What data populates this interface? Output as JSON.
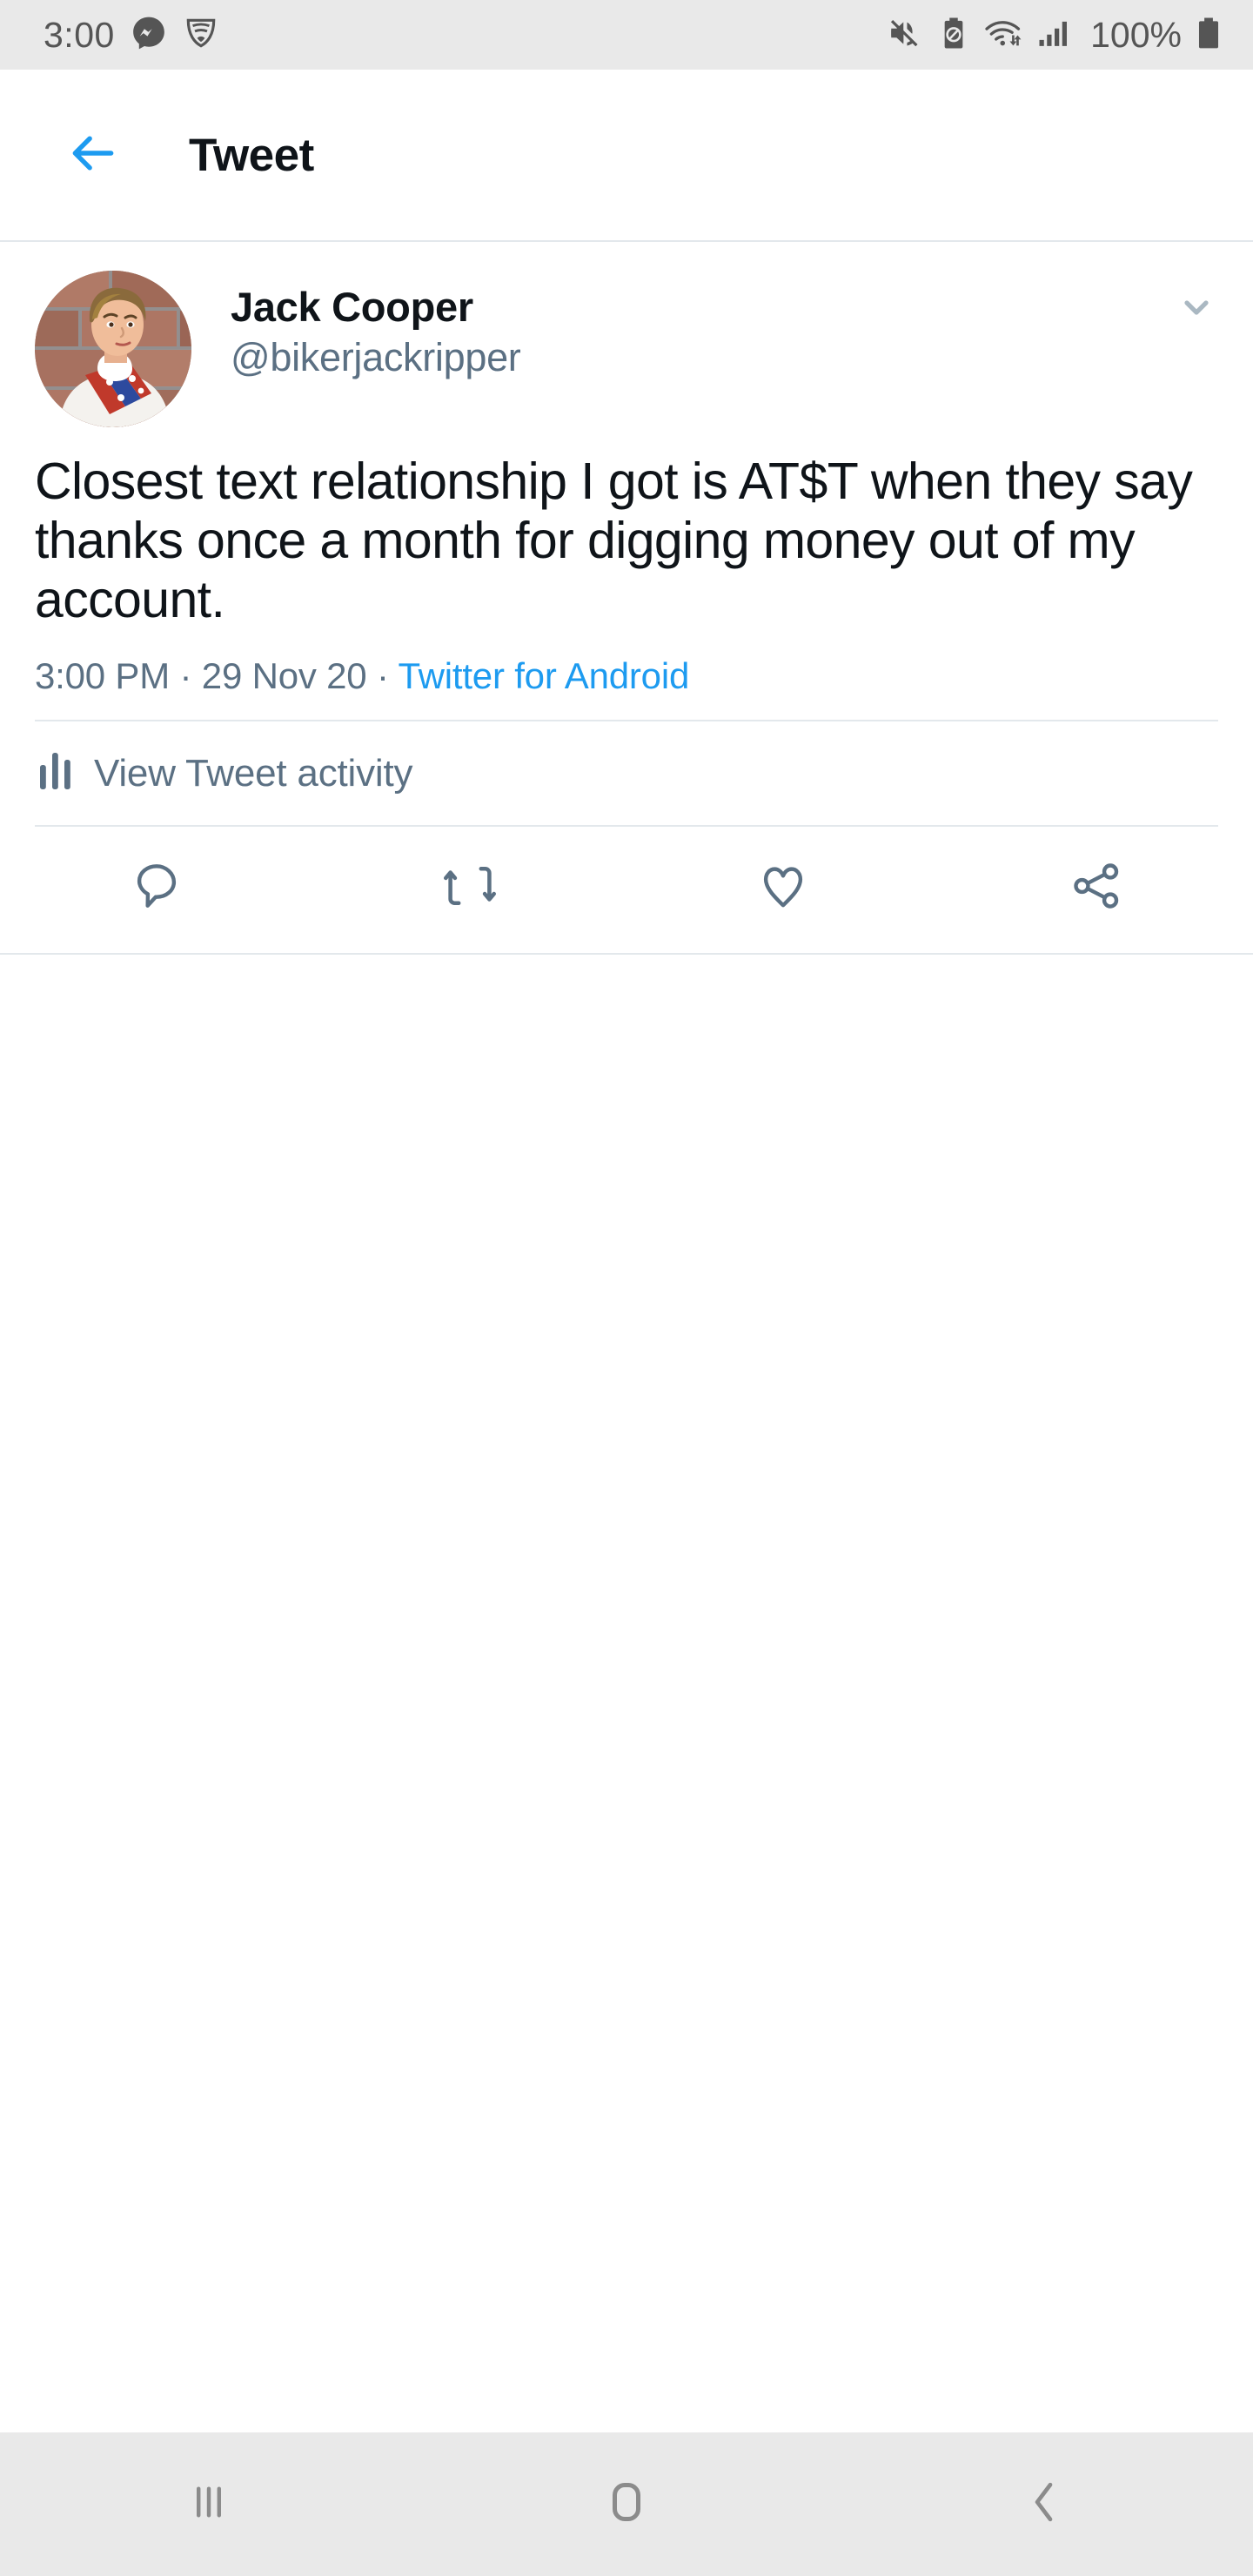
{
  "status_bar": {
    "clock": "3:00",
    "battery_percent": "100%",
    "left_icons": [
      "messenger-icon",
      "wifi-shield-icon"
    ],
    "right_icons": [
      "mute-icon",
      "battery-saver-icon",
      "wifi-icon",
      "cellular-signal-icon",
      "battery-icon"
    ],
    "bg_color": "#e9e9e9",
    "fg_color": "#555555"
  },
  "header": {
    "title": "Tweet",
    "back_icon": "arrow-left-icon",
    "accent_color": "#1d9bf0"
  },
  "tweet": {
    "author": {
      "display_name": "Jack Cooper",
      "handle": "@bikerjackripper",
      "avatar_alt": "Evel Knievel action figure in white jumpsuit against brick wall"
    },
    "menu_icon": "chevron-down-icon",
    "text": "Closest text relationship I got is AT$T when they say thanks once a month for digging money out of my account.",
    "meta": {
      "time": "3:00 PM",
      "separator": "·",
      "date": "29 Nov 20",
      "source": "Twitter for Android",
      "source_color": "#1d9bf0"
    },
    "activity": {
      "label": "View Tweet activity",
      "icon": "bar-chart-icon"
    },
    "actions": [
      {
        "name": "reply",
        "icon": "comment-icon",
        "count": ""
      },
      {
        "name": "retweet",
        "icon": "retweet-icon",
        "count": ""
      },
      {
        "name": "like",
        "icon": "heart-icon",
        "count": ""
      },
      {
        "name": "share",
        "icon": "share-icon",
        "count": ""
      }
    ],
    "muted_color": "#5b7083",
    "divider_color": "#e3e8ec"
  },
  "nav_bar": {
    "buttons": [
      {
        "name": "recents",
        "icon": "recents-icon"
      },
      {
        "name": "home",
        "icon": "home-square-icon"
      },
      {
        "name": "back",
        "icon": "chevron-left-icon"
      }
    ],
    "bg_color": "#e9e9e9",
    "fg_color": "#8b8b8b"
  }
}
